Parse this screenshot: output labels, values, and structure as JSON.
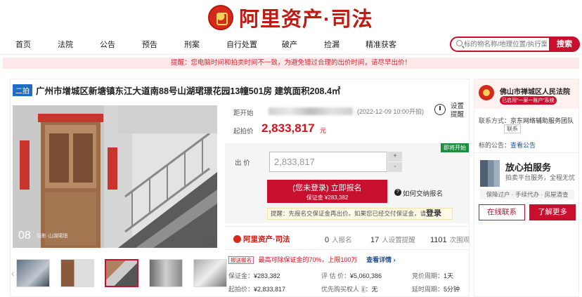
{
  "brand": {
    "name": "阿里资产·司法"
  },
  "nav": {
    "items": [
      "首页",
      "法院",
      "公告",
      "预告",
      "刑案",
      "自行处置",
      "破产",
      "捡漏",
      "精准获客"
    ]
  },
  "search": {
    "placeholder": "标的物名称/地理位置/执行案号",
    "button": "搜索"
  },
  "notice": "提醒：您电脑时间和拍卖时间不一致，为避免错过合理的出价时间，请尽早出价！",
  "item": {
    "tag": "二拍",
    "title": "广州市增城区新塘镇东江大道南88号山湖珺璟花园13幢501房 建筑面积208.4㎡",
    "photo_index": "08",
    "photo_caption": "摄影·山湖珺璟"
  },
  "auction": {
    "start_label": "距开始",
    "start_time": "(2022-12-09 10:00开拍)",
    "start_price_label": "起拍价",
    "start_price": "2,833,817",
    "currency": "元",
    "remind_label": "设置\n提醒",
    "status_badge": "即将开始",
    "bid_label": "出 价",
    "bid_value": "2,833,817",
    "plus": "+",
    "minus": "-",
    "signup_title": "(您未登录) 立即报名",
    "signup_deposit": "保证金 ¥283,382",
    "help": "如何交纳报名",
    "tip_text": "提醒：先报名交保证金再出价。如果您已经交付保证金，请",
    "tip_login": "登录"
  },
  "stats": {
    "brand": "阿里资产·司法",
    "signups": "0",
    "signups_label": "人报名",
    "reminders": "17",
    "reminders_label": "人设置提醒",
    "views": "1101",
    "views_label": "次围观"
  },
  "promo": {
    "tag": "报送报名",
    "text": "最高可除保证金的70%，上限100万",
    "more": "查看详情 ›"
  },
  "details": {
    "deposit_label": "保证金：",
    "deposit": "¥283,382",
    "appraisal_label": "评 估 价：",
    "appraisal": "¥5,060,386",
    "cycle_label": "竞价周期：",
    "cycle": "1天",
    "start_label": "起拍价：",
    "start": "¥2,833,817",
    "priority_label": "优先购买权人",
    "priority": "无",
    "delay_label": "延时周期：",
    "delay": "5分钟"
  },
  "sidebar": {
    "court": "佛山市禅城区人民法院",
    "court_badge": "已启用“一案一账户”系统",
    "contact_label": "联系方式：",
    "contact": "京东网络辅助服务团队",
    "phone": "联系",
    "announce_label": "标的公告：",
    "announce": "查看公告",
    "service_title": "放心拍服务",
    "service_sub": "拍卖平台服务，全程无忧",
    "service_features": "保障过户 · 手续代办 · 房屋清查",
    "btn_contact": "在线联系",
    "btn_more": "了解更多"
  }
}
